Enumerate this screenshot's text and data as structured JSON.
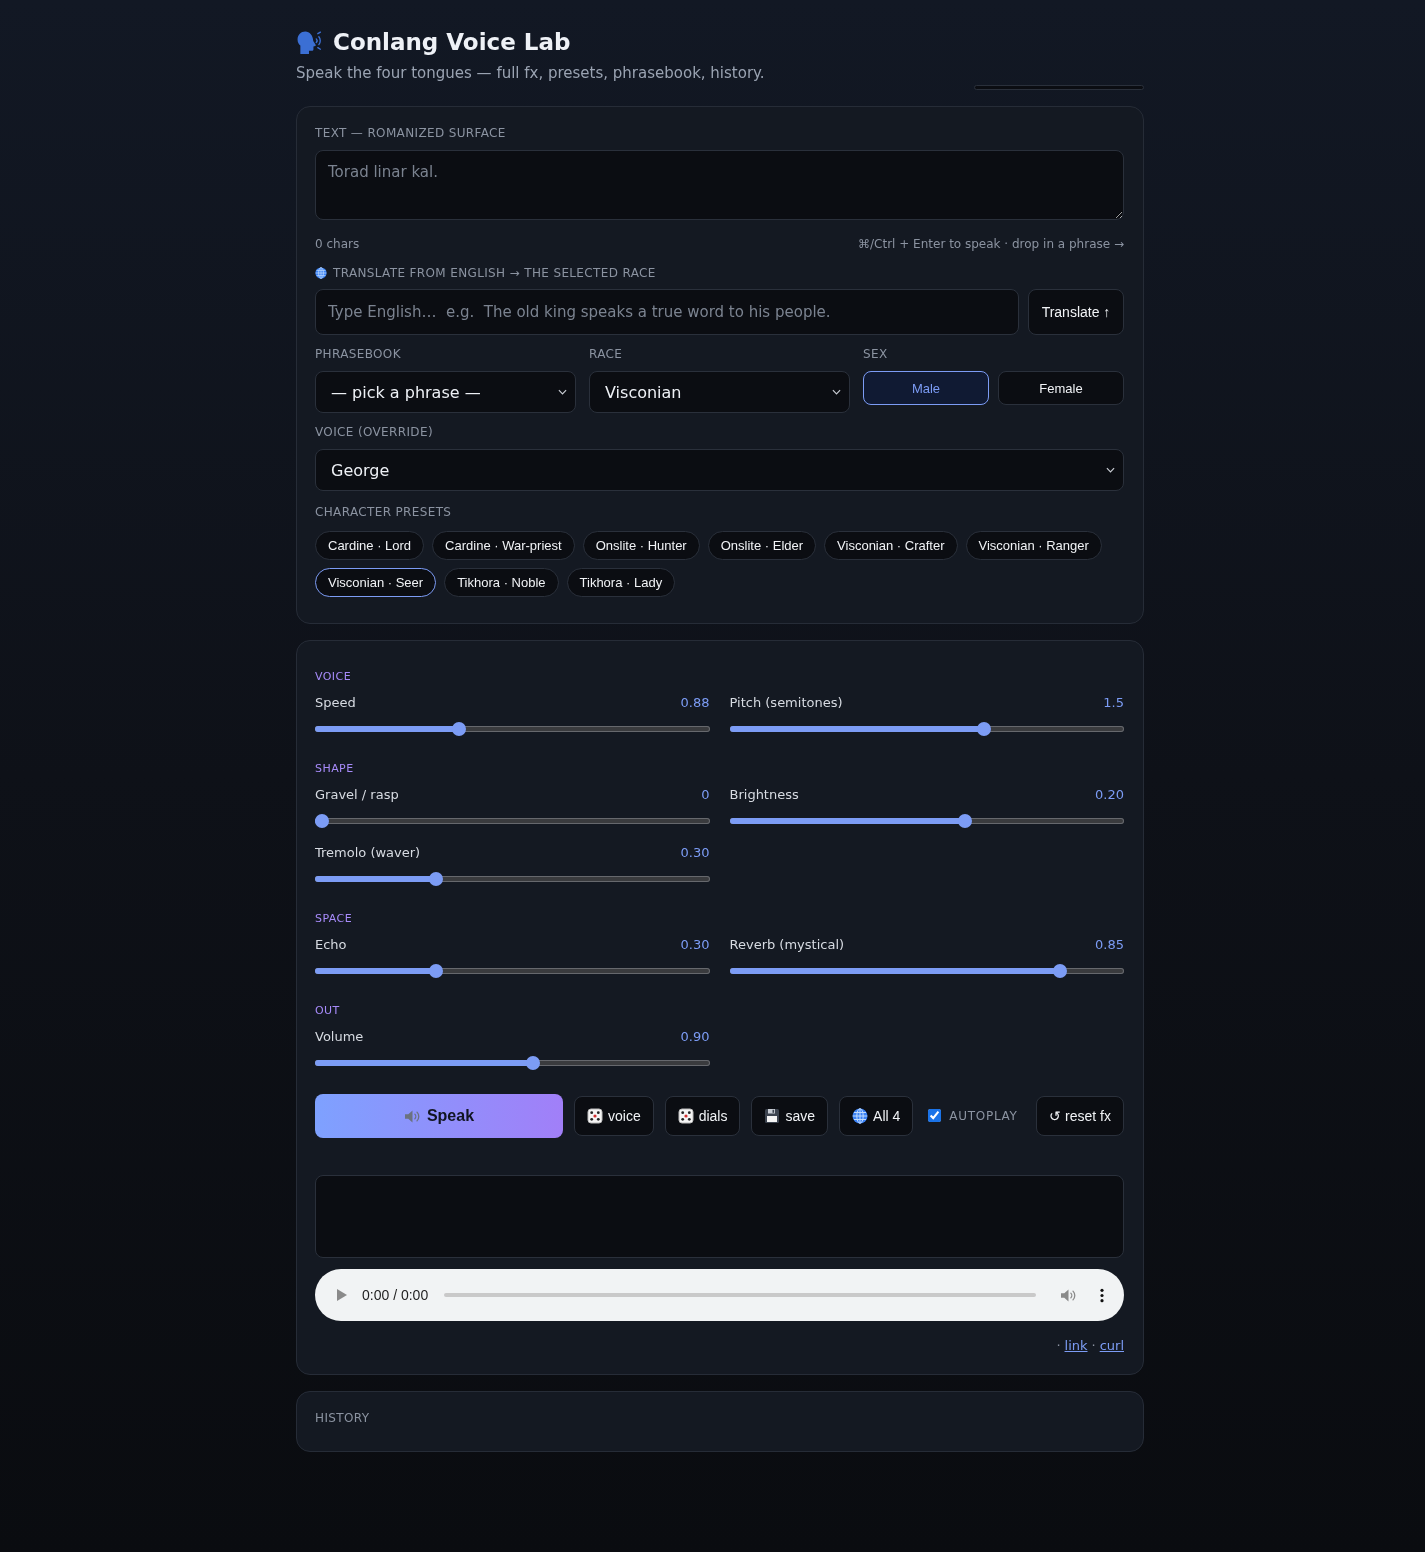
{
  "header": {
    "title": "Conlang Voice Lab",
    "subtitle": "Speak the four tongues — full fx, presets, phrasebook, history."
  },
  "text_card": {
    "label": "TEXT — ROMANIZED SURFACE",
    "text_field": {
      "placeholder": "Torad linar kal."
    },
    "char_count": "0 chars",
    "hint": "⌘/Ctrl + Enter to speak · drop in a phrase →",
    "translate": {
      "label": "TRANSLATE FROM ENGLISH → THE SELECTED RACE",
      "field": {
        "placeholder": "Type English…  e.g.  The old king speaks a true word to his people."
      },
      "button": "Translate ↑"
    },
    "phrasebook": {
      "label": "PHRASEBOOK",
      "value": "— pick a phrase —"
    },
    "race": {
      "label": "RACE",
      "value": "Visconian"
    },
    "sex": {
      "label": "SEX",
      "options": [
        {
          "label": "Male",
          "selected": true
        },
        {
          "label": "Female",
          "selected": false
        }
      ]
    },
    "voice_override": {
      "label": "VOICE (OVERRIDE)",
      "value": "George"
    },
    "presets": {
      "label": "CHARACTER PRESETS",
      "items": [
        {
          "label": "Cardine · Lord",
          "selected": false
        },
        {
          "label": "Cardine · War-priest",
          "selected": false
        },
        {
          "label": "Onslite · Hunter",
          "selected": false
        },
        {
          "label": "Onslite · Elder",
          "selected": false
        },
        {
          "label": "Visconian · Crafter",
          "selected": false
        },
        {
          "label": "Visconian · Ranger",
          "selected": false
        },
        {
          "label": "Visconian · Seer",
          "selected": true
        },
        {
          "label": "Tikhora · Noble",
          "selected": false
        },
        {
          "label": "Tikhora · Lady",
          "selected": false
        }
      ]
    }
  },
  "fx_panel": {
    "groups": [
      {
        "title": "VOICE",
        "sliders": [
          {
            "label": "Speed",
            "reading": "0.88",
            "level": 0.36
          },
          {
            "label": "Pitch (semitones)",
            "reading": "1.5",
            "level": 0.65
          }
        ]
      },
      {
        "title": "SHAPE",
        "sliders": [
          {
            "label": "Gravel / rasp",
            "reading": "0",
            "level": 0
          },
          {
            "label": "Brightness",
            "reading": "0.20",
            "level": 0.6
          },
          {
            "label": "Tremolo (waver)",
            "reading": "0.30",
            "level": 0.3
          }
        ]
      },
      {
        "title": "SPACE",
        "sliders": [
          {
            "label": "Echo",
            "reading": "0.30",
            "level": 0.3
          },
          {
            "label": "Reverb (mystical)",
            "reading": "0.85",
            "level": 0.85
          }
        ]
      },
      {
        "title": "OUT",
        "sliders": [
          {
            "label": "Volume",
            "reading": "0.90",
            "level": 0.555
          }
        ]
      }
    ],
    "speak_button": "Speak",
    "tool_buttons": [
      {
        "kind": "die",
        "label": "voice"
      },
      {
        "kind": "die",
        "label": "dials"
      },
      {
        "kind": "floppy",
        "label": "save"
      },
      {
        "kind": "globe",
        "label": "All 4"
      }
    ],
    "autoplay": {
      "label": "AUTOPLAY",
      "checked": true
    },
    "reset_button": "↺ reset fx",
    "player": {
      "time": "0:00 / 0:00"
    },
    "links": [
      {
        "separator": "·",
        "label": "link"
      },
      {
        "separator": "·",
        "label": "curl"
      }
    ]
  },
  "history": {
    "label": "HISTORY"
  }
}
